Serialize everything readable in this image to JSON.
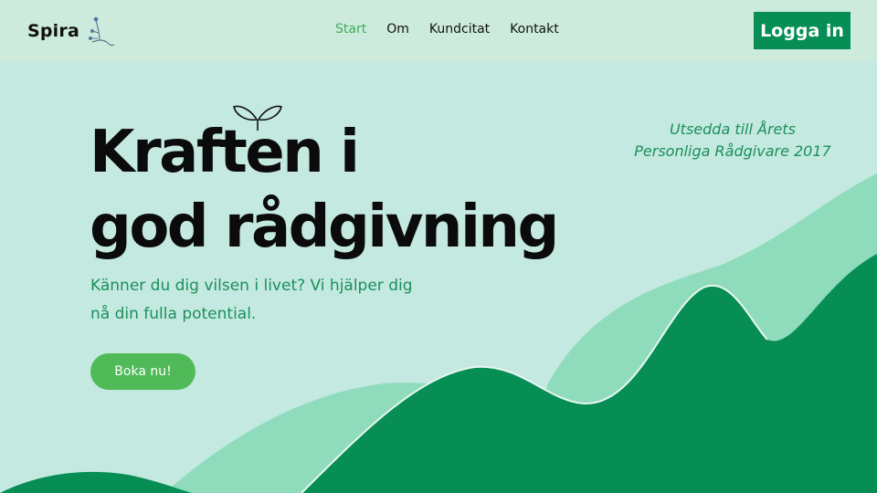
{
  "brand": {
    "name": "Spira",
    "logo_icon": "sprout-branch-icon"
  },
  "nav": {
    "items": [
      {
        "label": "Start",
        "active": true
      },
      {
        "label": "Om",
        "active": false
      },
      {
        "label": "Kundcitat",
        "active": false
      },
      {
        "label": "Kontakt",
        "active": false
      }
    ],
    "active_color": "#3fae5a"
  },
  "login": {
    "label": "Logga in",
    "color": "#068e55"
  },
  "hero": {
    "headline_line1": "Kraften i",
    "headline_line2": "god rådgivning",
    "headline_icon": "sprout-icon",
    "award_line1": "Utsedda till Årets",
    "award_line2": "Personliga Rådgivare 2017",
    "subtitle": "Känner du dig vilsen i livet? Vi hjälper dig nå din fulla potential.",
    "cta_label": "Boka nu!"
  },
  "colors": {
    "background": "#c4e9e0",
    "header": "#cdebdc",
    "text_green": "#1b8f5c",
    "hill_light": "#8fdcbc",
    "hill_dark": "#068e55",
    "cta": "#4fba57"
  }
}
